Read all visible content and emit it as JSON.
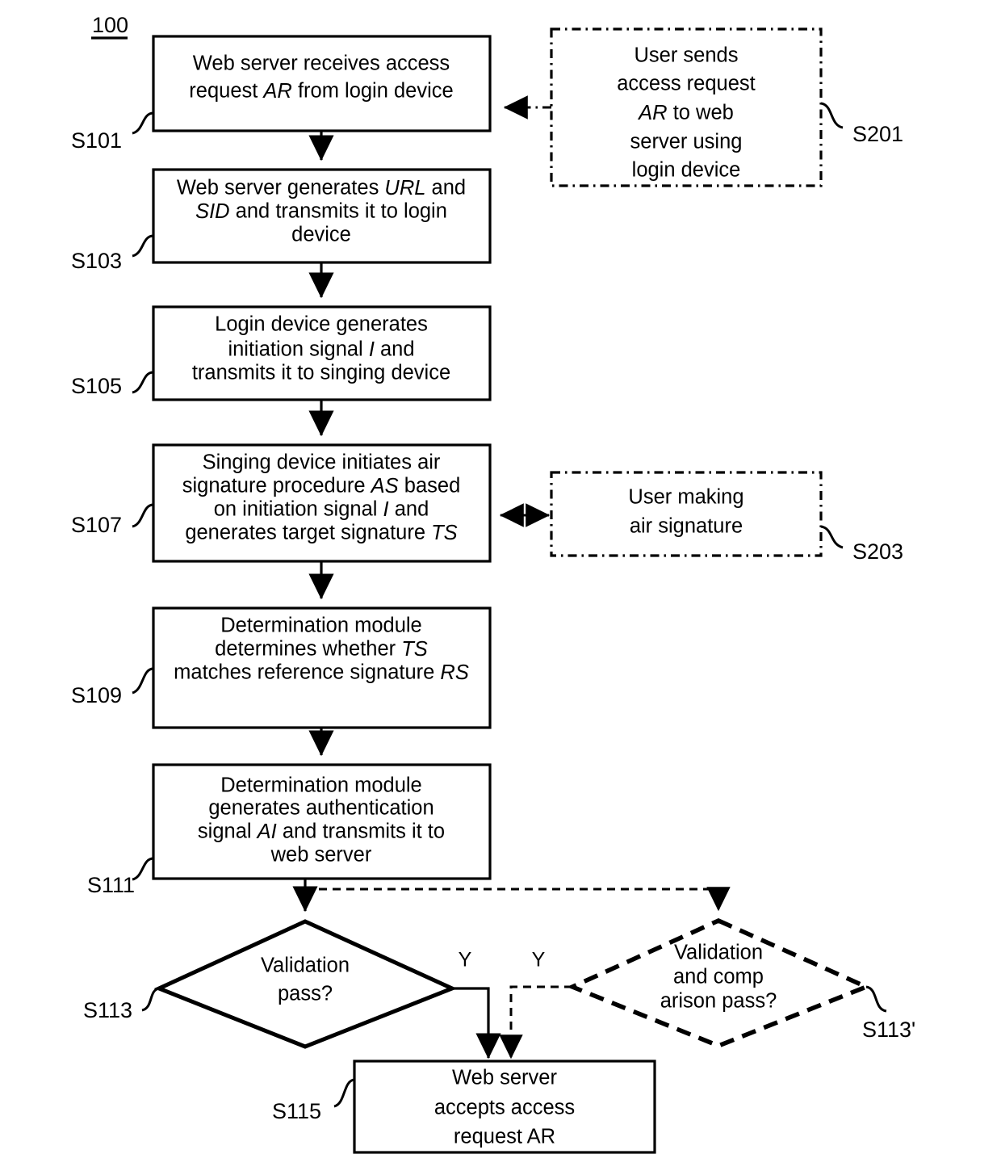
{
  "figure": {
    "number": "100"
  },
  "nodes": [
    {
      "id": "s101",
      "ref": "S101",
      "shape": "process",
      "lines": [
        [
          {
            "t": "Web server receives access",
            "i": false
          }
        ],
        [
          {
            "t": "request ",
            "i": false
          },
          {
            "t": "AR",
            "i": true
          },
          {
            "t": " from login device",
            "i": false
          }
        ]
      ]
    },
    {
      "id": "s103",
      "ref": "S103",
      "shape": "process",
      "lines": [
        [
          {
            "t": "Web server generates ",
            "i": false
          },
          {
            "t": "URL",
            "i": true
          },
          {
            "t": " and",
            "i": false
          }
        ],
        [
          {
            "t": "SID",
            "i": true
          },
          {
            "t": " and transmits it to login",
            "i": false
          }
        ],
        [
          {
            "t": "device",
            "i": false
          }
        ]
      ]
    },
    {
      "id": "s105",
      "ref": "S105",
      "shape": "process",
      "lines": [
        [
          {
            "t": "Login device generates",
            "i": false
          }
        ],
        [
          {
            "t": "initiation signal ",
            "i": false
          },
          {
            "t": "I",
            "i": true
          },
          {
            "t": " and",
            "i": false
          }
        ],
        [
          {
            "t": "transmits it to singing device",
            "i": false
          }
        ]
      ]
    },
    {
      "id": "s107",
      "ref": "S107",
      "shape": "process",
      "lines": [
        [
          {
            "t": "Singing device initiates air",
            "i": false
          }
        ],
        [
          {
            "t": "signature procedure ",
            "i": false
          },
          {
            "t": "AS",
            "i": true
          },
          {
            "t": " based",
            "i": false
          }
        ],
        [
          {
            "t": "on initiation signal ",
            "i": false
          },
          {
            "t": "I",
            "i": true
          },
          {
            "t": " and",
            "i": false
          }
        ],
        [
          {
            "t": "generates target signature ",
            "i": false
          },
          {
            "t": "TS",
            "i": true
          }
        ]
      ]
    },
    {
      "id": "s109",
      "ref": "S109",
      "shape": "process",
      "lines": [
        [
          {
            "t": "Determination module",
            "i": false
          }
        ],
        [
          {
            "t": "determines whether ",
            "i": false
          },
          {
            "t": "TS",
            "i": true
          }
        ],
        [
          {
            "t": "matches reference signature ",
            "i": false
          },
          {
            "t": "RS",
            "i": true
          }
        ]
      ]
    },
    {
      "id": "s111",
      "ref": "S111",
      "shape": "process",
      "lines": [
        [
          {
            "t": "Determination module",
            "i": false
          }
        ],
        [
          {
            "t": "generates authentication",
            "i": false
          }
        ],
        [
          {
            "t": "signal ",
            "i": false
          },
          {
            "t": "AI",
            "i": true
          },
          {
            "t": " and transmits it to",
            "i": false
          }
        ],
        [
          {
            "t": "web server",
            "i": false
          }
        ]
      ]
    },
    {
      "id": "s113",
      "ref": "S113",
      "shape": "decision",
      "lines": [
        [
          {
            "t": "Validation",
            "i": false
          }
        ],
        [
          {
            "t": "pass?",
            "i": false
          }
        ]
      ]
    },
    {
      "id": "s113prime",
      "ref": "S113'",
      "shape": "decision-dashed",
      "lines": [
        [
          {
            "t": "Validation",
            "i": false
          }
        ],
        [
          {
            "t": "and comp",
            "i": false
          }
        ],
        [
          {
            "t": "arison pass?",
            "i": false
          }
        ]
      ]
    },
    {
      "id": "s115",
      "ref": "S115",
      "shape": "process",
      "lines": [
        [
          {
            "t": "Web server",
            "i": false
          }
        ],
        [
          {
            "t": "accepts access",
            "i": false
          }
        ],
        [
          {
            "t": "request AR",
            "i": false
          }
        ]
      ]
    },
    {
      "id": "s201",
      "ref": "S201",
      "shape": "actor",
      "lines": [
        [
          {
            "t": "User sends",
            "i": false
          }
        ],
        [
          {
            "t": "access request",
            "i": false
          }
        ],
        [
          {
            "t": "AR",
            "i": true
          },
          {
            "t": " to web",
            "i": false
          }
        ],
        [
          {
            "t": "server using",
            "i": false
          }
        ],
        [
          {
            "t": "login device",
            "i": false
          }
        ]
      ]
    },
    {
      "id": "s203",
      "ref": "S203",
      "shape": "actor",
      "lines": [
        [
          {
            "t": "User making",
            "i": false
          }
        ],
        [
          {
            "t": "air signature",
            "i": false
          }
        ]
      ]
    }
  ],
  "branch_labels": {
    "yes_solid": "Y",
    "yes_dashed": "Y"
  },
  "colors": {
    "stroke": "#000000",
    "fill": "#ffffff"
  }
}
